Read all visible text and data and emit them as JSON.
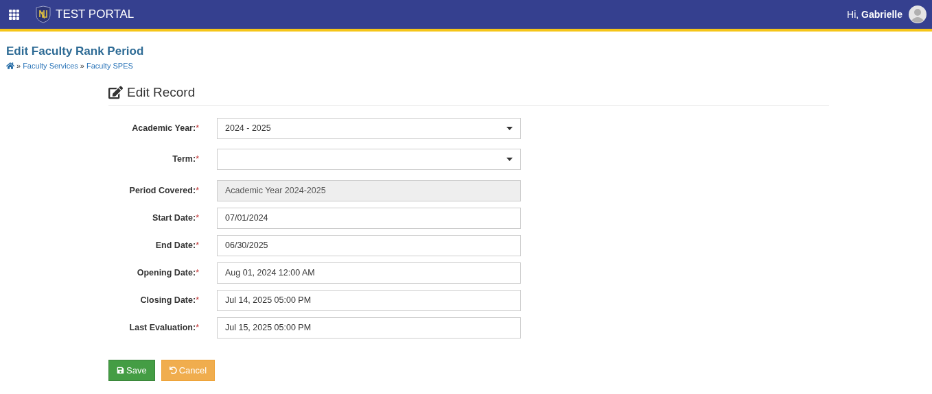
{
  "header": {
    "title": "TEST PORTAL",
    "greeting": "Hi,",
    "user": "Gabrielle"
  },
  "page": {
    "title": "Edit Faculty Rank Period",
    "breadcrumbs": [
      "Faculty Services",
      "Faculty SPES"
    ],
    "separator": "»"
  },
  "form": {
    "title": "Edit Record",
    "fields": [
      {
        "label": "Academic Year:",
        "marker": "*",
        "kind": "select",
        "value": "2024 - 2025",
        "disabled": false
      },
      {
        "label": "Term:",
        "marker": "*",
        "kind": "select",
        "disabled": false
      },
      {
        "label": "Period Covered:",
        "marker": "*",
        "kind": "input",
        "value": "Academic Year 2024-2025",
        "disabled": true
      },
      {
        "label": "Start Date:",
        "marker": "*",
        "kind": "input",
        "value": "07/01/2024",
        "disabled": false
      },
      {
        "label": "End Date:",
        "marker": "*",
        "kind": "input",
        "value": "06/30/2025",
        "disabled": false
      },
      {
        "label": "Opening Date:",
        "marker": "*",
        "kind": "input",
        "value": "Aug 01, 2024 12:00 AM",
        "disabled": false
      },
      {
        "label": "Closing Date:",
        "marker": "*",
        "kind": "input",
        "value": "Jul 14, 2025 05:00 PM",
        "disabled": false
      },
      {
        "label": "Last Evaluation:",
        "marker": "*",
        "kind": "input",
        "value": "Jul 15, 2025 05:00 PM",
        "disabled": false
      }
    ],
    "buttons": [
      {
        "label": "Save",
        "kind": "save"
      },
      {
        "label": "Cancel",
        "kind": "cancel"
      }
    ]
  }
}
